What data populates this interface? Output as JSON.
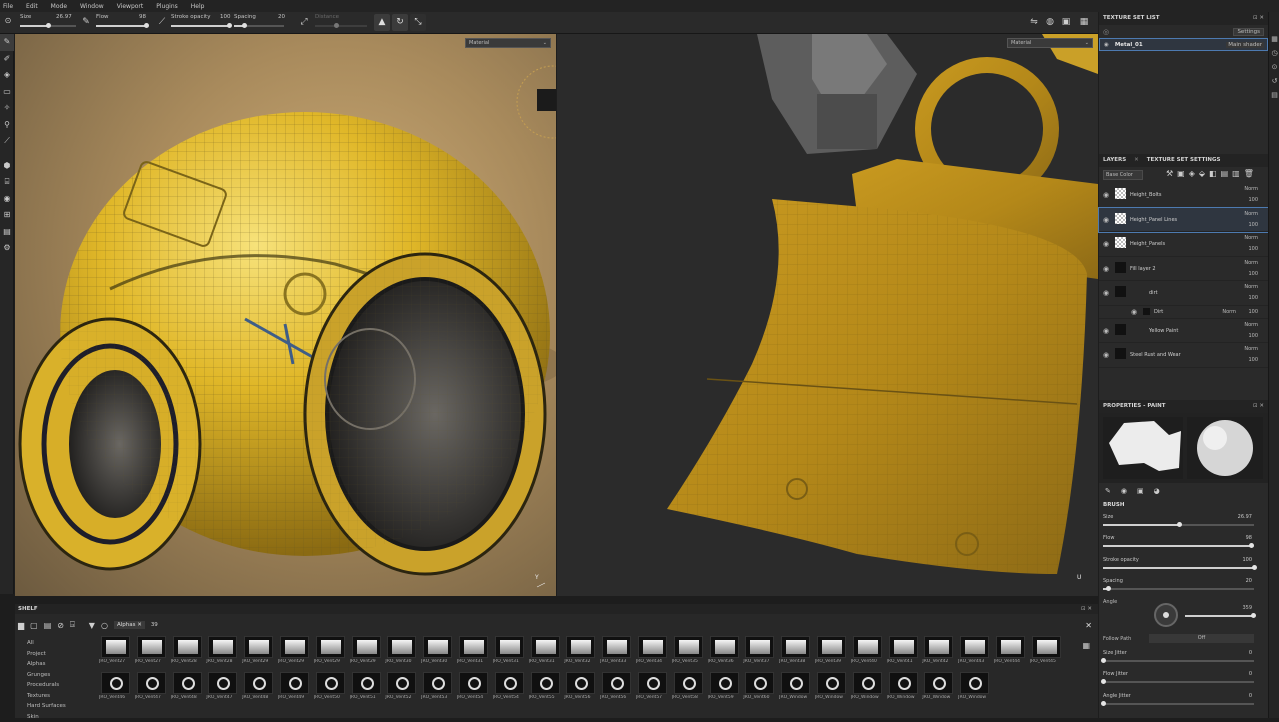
{
  "menu": [
    "File",
    "Edit",
    "Mode",
    "Window",
    "Viewport",
    "Plugins",
    "Help"
  ],
  "toolbar": {
    "size_label": "Size",
    "size_value": "26.97",
    "size_pos": 0.27,
    "flow_label": "Flow",
    "flow_value": "98",
    "flow_pos": 0.98,
    "stroke_label": "Stroke opacity",
    "stroke_value": "100",
    "stroke_pos": 1.0,
    "spacing_label": "Spacing",
    "spacing_value": "20",
    "spacing_pos": 0.2,
    "distance_label": "Distance"
  },
  "viewport3d": {
    "mode": "Material"
  },
  "viewport2d": {
    "mode": "Material"
  },
  "texture_set_list": {
    "title": "TEXTURE SET LIST",
    "settings_label": "Settings",
    "item": "Metal_01",
    "shader": "Main shader"
  },
  "layers_panel": {
    "tab_layers": "LAYERS",
    "tab_settings": "TEXTURE SET SETTINGS",
    "channel": "Base Color",
    "layers": [
      {
        "name": "Height_Bolts",
        "blend": "Norm",
        "opacity": "100"
      },
      {
        "name": "Height_Panel Lines",
        "blend": "Norm",
        "opacity": "100"
      },
      {
        "name": "Height_Panels",
        "blend": "Norm",
        "opacity": "100"
      },
      {
        "name": "Fill layer 2",
        "blend": "Norm",
        "opacity": "100"
      },
      {
        "name": "dirt",
        "blend": "Norm",
        "opacity": "100"
      },
      {
        "name": "Dirt",
        "blend": "Norm",
        "opacity": "100"
      },
      {
        "name": "Yellow Paint",
        "blend": "Norm",
        "opacity": "100"
      },
      {
        "name": "Steel Rust and Wear",
        "blend": "Norm",
        "opacity": "100"
      }
    ]
  },
  "properties": {
    "title": "PROPERTIES - PAINT",
    "section": "BRUSH",
    "size_label": "Size",
    "size_value": "26.97",
    "size_pos": 0.5,
    "flow_label": "Flow",
    "flow_value": "98",
    "flow_pos": 0.98,
    "stroke_label": "Stroke opacity",
    "stroke_value": "100",
    "stroke_pos": 1.0,
    "spacing_label": "Spacing",
    "spacing_value": "20",
    "spacing_pos": 0.03,
    "angle_label": "Angle",
    "angle_value": "359",
    "follow_path_label": "Follow Path",
    "follow_path_value": "Off",
    "size_jitter_label": "Size Jitter",
    "size_jitter_value": "0",
    "flow_jitter_label": "Flow Jitter",
    "flow_jitter_value": "0",
    "angle_jitter_label": "Angle Jitter",
    "angle_jitter_value": "0"
  },
  "shelf": {
    "title": "SHELF",
    "filter_tag": "Alphas",
    "search": "39",
    "categories": [
      "All",
      "Project",
      "Alphas",
      "Grunges",
      "Procedurals",
      "Textures",
      "Hard Surfaces",
      "Skin"
    ],
    "row1": [
      "JRO_Vent27",
      "JRO_Vent27",
      "JRO_Vent28",
      "JRO_Vent28",
      "JRO_Vent29",
      "JRO_Vent29",
      "JRO_Vent29",
      "JRO_Vent29",
      "JRO_Vent30",
      "JRO_Vent30",
      "JRO_Vent31",
      "JRO_Vent31",
      "JRO_Vent31",
      "JRO_Vent32",
      "JRO_Vent33",
      "JRO_Vent34",
      "JRO_Vent35",
      "JRO_Vent36",
      "JRO_Vent37",
      "JRO_Vent38",
      "JRO_Vent39",
      "JRO_Vent40",
      "JRO_Vent41",
      "JRO_Vent42",
      "JRO_Vent43",
      "JRO_Vent44",
      "JRO_Vent45"
    ],
    "row2": [
      "JRO_Vent46",
      "JRO_Vent47",
      "JRO_Vent48",
      "JRO_Vent47",
      "JRO_Vent48",
      "JRO_Vent49",
      "JRO_Vent50",
      "JRO_Vent51",
      "JRO_Vent52",
      "JRO_Vent53",
      "JRO_Vent54",
      "JRO_Vent54",
      "JRO_Vent55",
      "JRO_Vent56",
      "JRO_Vent56",
      "JRO_Vent57",
      "JRO_Vent58",
      "JRO_Vent59",
      "JRO_Vent60",
      "JRO_Window",
      "JRO_Window",
      "JRO_Window",
      "JRO_Window",
      "JRO_Window",
      "JRO_Window"
    ]
  },
  "colors": {
    "accent": "#4d7ab0",
    "paint_yellow": "#d9b12a"
  }
}
